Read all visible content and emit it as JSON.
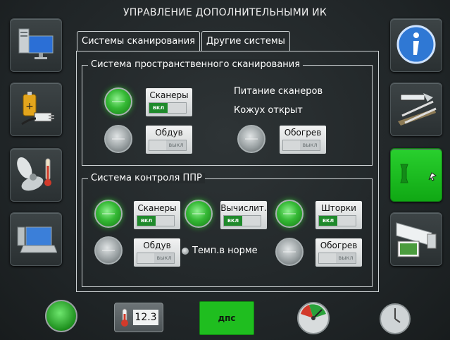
{
  "header": {
    "title": "УПРАВЛЕНИЕ ДОПОЛНИТЕЛЬНЫМИ ИК"
  },
  "tabs": [
    {
      "label": "Системы сканирования",
      "active": true
    },
    {
      "label": "Другие системы",
      "active": false
    }
  ],
  "left_sidebar": [
    {
      "icon": "computer-monitor-icon"
    },
    {
      "icon": "battery-plug-icon"
    },
    {
      "icon": "fan-thermometer-icon"
    },
    {
      "icon": "laptop-icon"
    }
  ],
  "right_sidebar": [
    {
      "icon": "info-icon"
    },
    {
      "icon": "rail-track-icon"
    },
    {
      "icon": "rail-profile-icon",
      "active": true
    },
    {
      "icon": "camera-icon"
    }
  ],
  "group_space": {
    "title": "Система  пространственного сканирования",
    "controls": [
      {
        "name": "scanners",
        "label": "Сканеры",
        "on": true,
        "toggle": "вкл"
      },
      {
        "name": "blowing",
        "label": "Обдув",
        "on": false,
        "toggle": "выкл"
      },
      {
        "name": "heating",
        "label": "Обогрев",
        "on": false,
        "toggle": "выкл"
      }
    ],
    "status_1": "Питание сканеров",
    "status_2": "Кожух открыт"
  },
  "group_ppr": {
    "title": "Система контроля ППР",
    "controls": [
      {
        "name": "scanners",
        "label": "Сканеры",
        "on": true,
        "toggle": "вкл"
      },
      {
        "name": "compute",
        "label": "Вычислит.",
        "on": true,
        "toggle": "вкл"
      },
      {
        "name": "shutters",
        "label": "Шторки",
        "on": true,
        "toggle": "вкл"
      },
      {
        "name": "blowing",
        "label": "Обдув",
        "on": false,
        "toggle": "выкл"
      },
      {
        "name": "heating",
        "label": "Обогрев",
        "on": false,
        "toggle": "выкл"
      }
    ],
    "temp_status": "Темп.в норме"
  },
  "bottom": {
    "temperature": "12.3",
    "dps_label": "дпс"
  },
  "colors": {
    "led_on": "#35b935",
    "toggle_on": "#1f8a2b",
    "dps": "#1fbe1f"
  }
}
